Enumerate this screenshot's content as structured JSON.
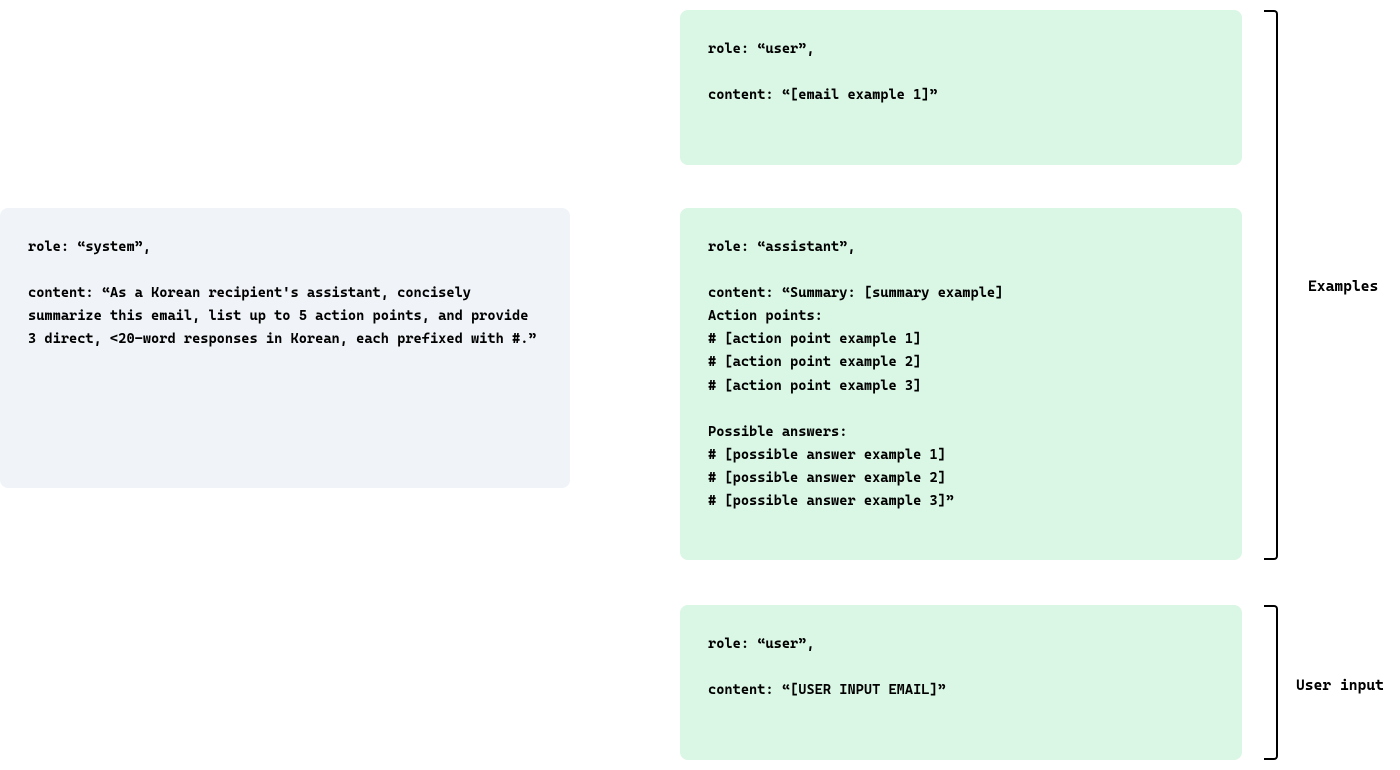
{
  "system_card": {
    "text": "role: “system”,\n\ncontent: “As a Korean recipient's assistant, concisely summarize this email, list up to 5 action points, and provide 3 direct, <20-word responses in Korean, each prefixed with #.”"
  },
  "example_user": {
    "text": "role: “user”,\n\ncontent: “[email example 1]”"
  },
  "example_assistant": {
    "text": "role: “assistant”,\n\ncontent: “Summary: [summary example]\nAction points:\n# [action point example 1]\n# [action point example 2]\n# [action point example 3]\n\nPossible answers:\n# [possible answer example 1]\n# [possible answer example 2]\n# [possible answer example 3]”"
  },
  "user_input": {
    "text": "role: “user”,\n\ncontent: “[USER INPUT EMAIL]”"
  },
  "labels": {
    "examples": "Examples",
    "user_input": "User input"
  }
}
